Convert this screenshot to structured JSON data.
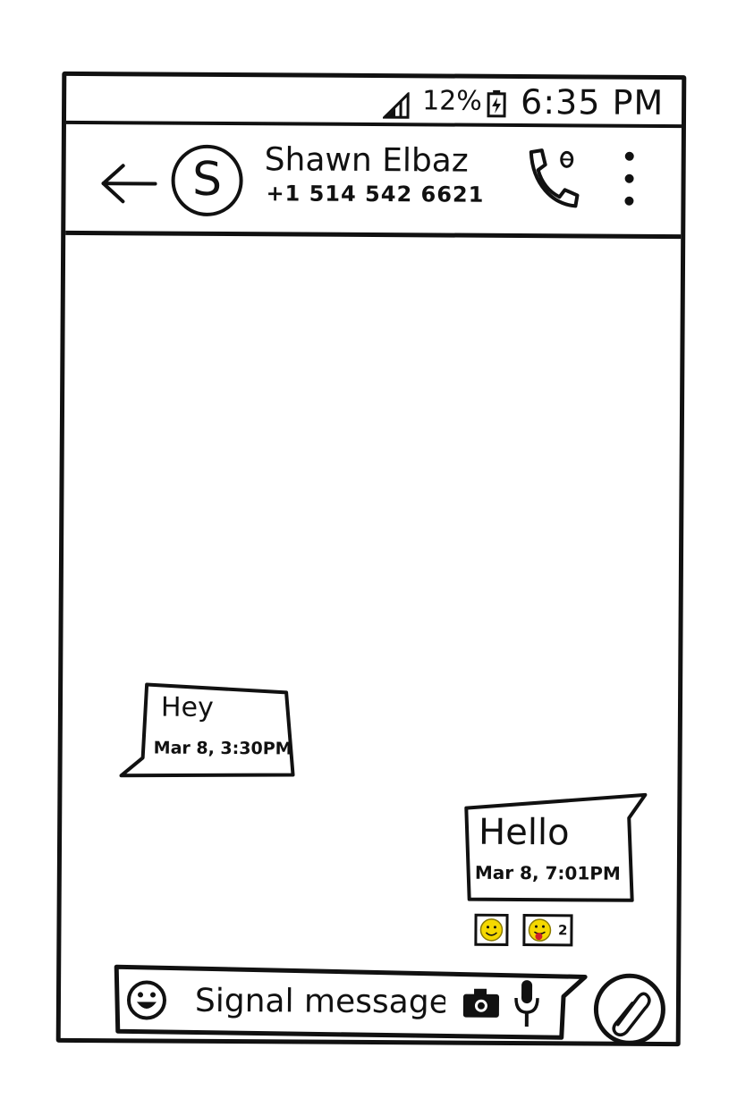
{
  "status_bar": {
    "battery_percent": "12%",
    "time": "6:35 PM",
    "icons": [
      "signal-icon",
      "battery-charging-icon"
    ]
  },
  "header": {
    "avatar_letter": "S",
    "contact_name": "Shawn Elbaz",
    "contact_number": "+1 514 542 6621",
    "icons": [
      "back-arrow-icon",
      "call-icon",
      "more-vertical-icon"
    ]
  },
  "messages": [
    {
      "direction": "incoming",
      "text": "Hey",
      "timestamp": "Mar 8, 3:30PM"
    },
    {
      "direction": "outgoing",
      "text": "Hello",
      "timestamp": "Mar 8, 7:01PM",
      "reactions": [
        {
          "icon": "smile-emoji-icon",
          "count": ""
        },
        {
          "icon": "tongue-emoji-icon",
          "count": "2"
        }
      ]
    }
  ],
  "composer": {
    "placeholder": "Signal message",
    "icons": [
      "emoji-icon",
      "camera-icon",
      "microphone-icon",
      "attach-icon"
    ]
  },
  "colors": {
    "ink": "#111111",
    "reaction_yellow": "#f5d800",
    "reaction_red": "#d0202a"
  }
}
